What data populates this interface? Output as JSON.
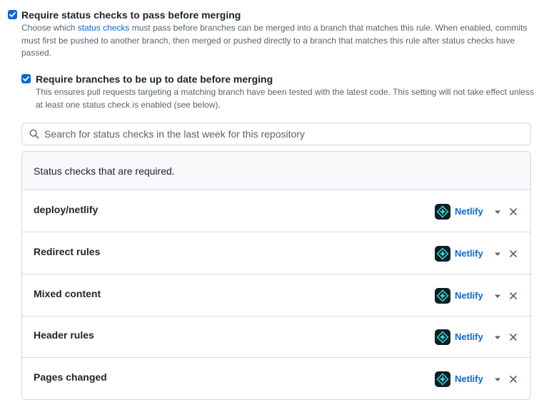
{
  "settings": {
    "require_status_checks": {
      "checked": true,
      "title": "Require status checks to pass before merging",
      "desc_before_link": "Choose which ",
      "link_text": "status checks",
      "desc_after_link": " must pass before branches can be merged into a branch that matches this rule. When enabled, commits must first be pushed to another branch, then merged or pushed directly to a branch that matches this rule after status checks have passed."
    },
    "require_up_to_date": {
      "checked": true,
      "title": "Require branches to be up to date before merging",
      "desc": "This ensures pull requests targeting a matching branch have been tested with the latest code. This setting will not take effect unless at least one status check is enabled (see below)."
    }
  },
  "search": {
    "icon": "search-icon",
    "placeholder": "Search for status checks in the last week for this repository",
    "value": ""
  },
  "required_checks": {
    "header": "Status checks that are required.",
    "items": [
      {
        "name": "deploy/netlify",
        "provider": "Netlify"
      },
      {
        "name": "Redirect rules",
        "provider": "Netlify"
      },
      {
        "name": "Mixed content",
        "provider": "Netlify"
      },
      {
        "name": "Header rules",
        "provider": "Netlify"
      },
      {
        "name": "Pages changed",
        "provider": "Netlify"
      }
    ]
  },
  "colors": {
    "accent": "#0969da",
    "text": "#1f2328",
    "muted": "#59636e",
    "border": "#d1d9e0",
    "header_bg": "#f6f8fa",
    "netlify_bg": "#0e1e25",
    "netlify_teal": "#32e6e2"
  }
}
